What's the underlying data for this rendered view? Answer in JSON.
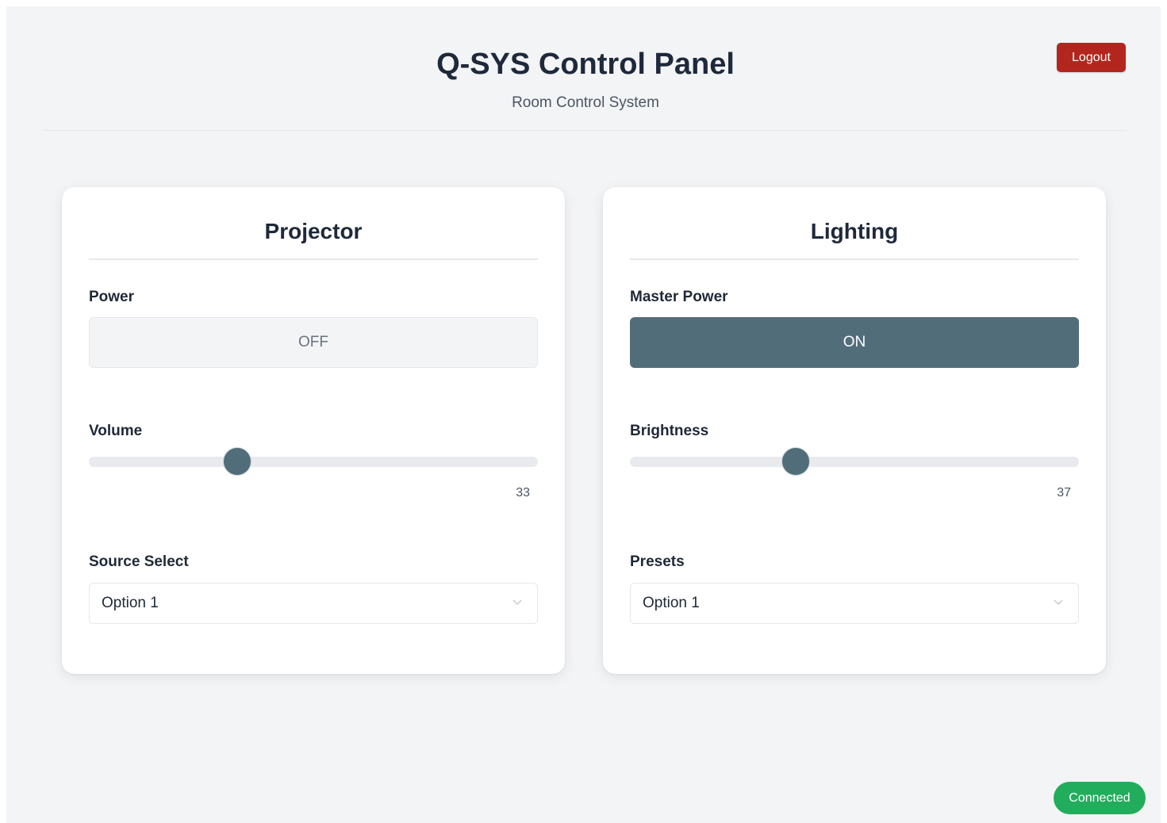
{
  "header": {
    "title": "Q-SYS Control Panel",
    "subtitle": "Room Control System",
    "logout_label": "Logout"
  },
  "projector": {
    "title": "Projector",
    "power_label": "Power",
    "power_state": "OFF",
    "volume_label": "Volume",
    "volume_value": 33,
    "source_label": "Source Select",
    "source_selected": "Option 1"
  },
  "lighting": {
    "title": "Lighting",
    "power_label": "Master Power",
    "power_state": "ON",
    "brightness_label": "Brightness",
    "brightness_value": 37,
    "presets_label": "Presets",
    "preset_selected": "Option 1"
  },
  "status": {
    "text": "Connected",
    "color": "#22ad5c"
  },
  "colors": {
    "accent": "#526d7a",
    "logout": "#b3261e",
    "background": "#f3f4f6"
  },
  "icons": {
    "select_chevron": "chevron-down-icon"
  }
}
